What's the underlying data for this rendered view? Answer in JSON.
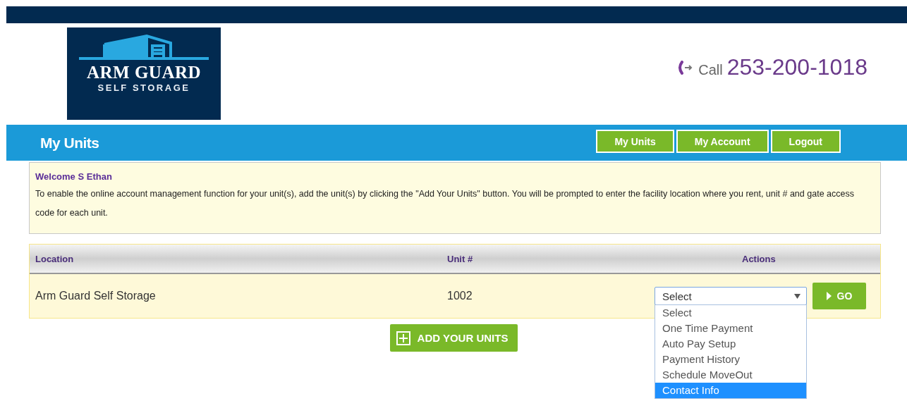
{
  "logo": {
    "name": "ARM GUARD",
    "tagline": "SELF STORAGE"
  },
  "phone": {
    "label": "Call",
    "number": "253-200-1018"
  },
  "page_title": "My Units",
  "nav": [
    {
      "label": "My Units"
    },
    {
      "label": "My Account"
    },
    {
      "label": "Logout"
    }
  ],
  "welcome": {
    "greeting": "Welcome S Ethan",
    "message": "To enable the online account management function for your unit(s), add the unit(s) by clicking the \"Add Your Units\" button. You will be prompted to enter the facility location where you rent, unit # and gate access code for each unit."
  },
  "table": {
    "columns": [
      "Location",
      "Unit #",
      "Actions"
    ],
    "rows": [
      {
        "location": "Arm Guard Self Storage",
        "unit": "1002",
        "action_value": "Select",
        "go_label": "GO"
      }
    ]
  },
  "dropdown": {
    "options": [
      {
        "label": "Select",
        "selected": false
      },
      {
        "label": "One Time Payment",
        "selected": false
      },
      {
        "label": "Auto Pay Setup",
        "selected": false
      },
      {
        "label": "Payment History",
        "selected": false
      },
      {
        "label": "Schedule MoveOut",
        "selected": false
      },
      {
        "label": "Contact Info",
        "selected": true
      }
    ]
  },
  "add_button": "ADD YOUR UNITS"
}
